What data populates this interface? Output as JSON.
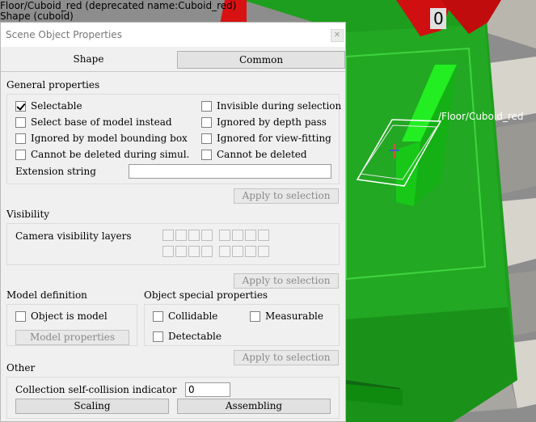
{
  "viewport": {
    "top_text_line1": "Floor/Cuboid_red   (deprecated name:Cuboid_red)",
    "top_text_line2": "Shape (cuboid)",
    "object_label": "/Floor/Cuboid_red",
    "marker_digit": "0",
    "colors": {
      "floor_green": "#1fa51f",
      "bright_green": "#22ee22",
      "dark_green": "#0d6e0d",
      "red": "#d01010",
      "tile_light": "#d7d4cc",
      "tile_dark": "#8d8d8d"
    }
  },
  "dialog": {
    "title": "Scene Object Properties",
    "close_icon": "close-icon",
    "tabs": [
      {
        "label": "Shape",
        "selected": false
      },
      {
        "label": "Common",
        "selected": true
      }
    ],
    "general": {
      "heading": "General properties",
      "left": [
        {
          "label": "Selectable",
          "checked": true
        },
        {
          "label": "Select base of model instead",
          "checked": false
        },
        {
          "label": "Ignored by model bounding  box",
          "checked": false
        },
        {
          "label": "Cannot be deleted during simul.",
          "checked": false
        }
      ],
      "right": [
        {
          "label": "Invisible during selection",
          "checked": false
        },
        {
          "label": "Ignored by depth pass",
          "checked": false
        },
        {
          "label": "Ignored for view-fitting",
          "checked": false
        },
        {
          "label": "Cannot be deleted",
          "checked": false
        }
      ],
      "extension_label": "Extension string",
      "extension_value": "",
      "apply_label": "Apply to selection"
    },
    "visibility": {
      "heading": "Visibility",
      "camera_layers_label": "Camera visibility layers",
      "apply_label": "Apply to selection"
    },
    "model": {
      "heading": "Model definition",
      "object_is_model_label": "Object is model",
      "object_is_model_checked": false,
      "model_properties_label": "Model properties"
    },
    "special": {
      "heading": "Object special properties",
      "collidable_label": "Collidable",
      "measurable_label": "Measurable",
      "detectable_label": "Detectable",
      "apply_label": "Apply to selection"
    },
    "other": {
      "heading": "Other",
      "collection_label": "Collection self-collision indicator",
      "collection_value": "0",
      "scaling_label": "Scaling",
      "assembling_label": "Assembling"
    }
  }
}
